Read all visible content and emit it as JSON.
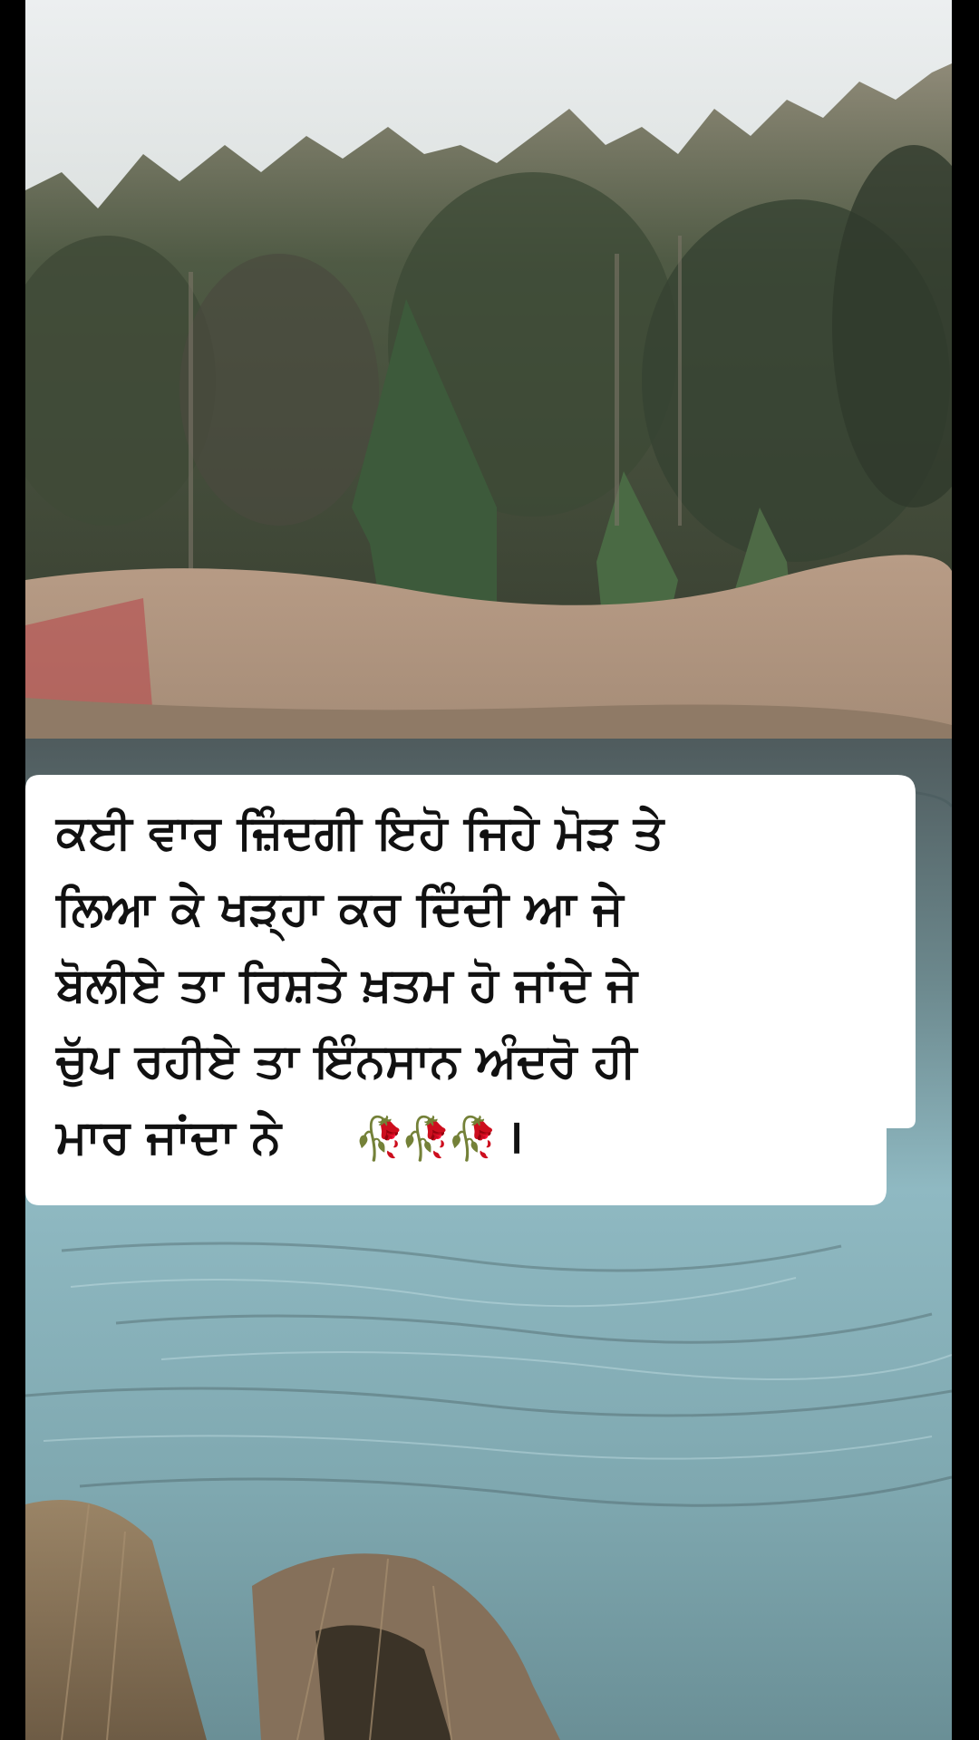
{
  "post": {
    "caption_lines": [
      "ਕਈ ਵਾਰ ਜ਼ਿੰਦਗੀ ਇਹੋ ਜਿਹੇ ਮੋੜ ਤੇ",
      "ਲਿਆ ਕੇ ਖੜ੍ਹਾ ਕਰ ਦਿੰਦੀ ਆ ਜੇ",
      "ਬੋਲੀਏ ਤਾ ਰਿਸ਼ਤੇ ਖ਼ਤਮ ਹੋ ਜਾਂਦੇ ਜੇ",
      "ਚੁੱਪ ਰਹੀਏ ਤਾ ਇੰਨਸਾਨ ਅੰਦਰੋ ਹੀ",
      "ਮਾਰ ਜਾਂਦਾ ਨੇ"
    ],
    "caption_emoji": "🥀🥀🥀",
    "caption_end": "।"
  },
  "colors": {
    "caption_background": "#ffffff",
    "caption_text": "#111111",
    "side_bars": "#000000"
  }
}
